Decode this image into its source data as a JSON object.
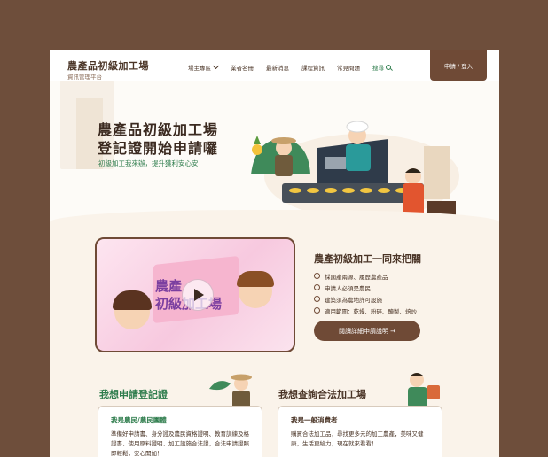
{
  "header": {
    "logo_title": "農產品初級加工場",
    "logo_subtitle": "資訊管理平台",
    "nav": [
      {
        "label": "場主專區",
        "has_dropdown": true
      },
      {
        "label": "業者名冊"
      },
      {
        "label": "最新消息"
      },
      {
        "label": "課程資訊"
      },
      {
        "label": "常見問題"
      },
      {
        "label": "搜尋",
        "icon": "search-icon"
      }
    ],
    "login_label": "申請 / 登入"
  },
  "hero": {
    "title_line1": "農產品初級加工場",
    "title_line2": "登記證開始申請囉",
    "subtitle": "初級加工我來辦，提升獲利安心安"
  },
  "video": {
    "text_line1": "農產",
    "text_line2": "初級加工場"
  },
  "info": {
    "title": "農產初級加工一同來把關",
    "items": [
      "採國產兩源、履歷農產品",
      "申請人必須是農民",
      "建築須為農地許可設施",
      "適用範圍：乾燥、粉碎、醃製、焙炒"
    ],
    "button_label": "閱讀詳細申請說明 →"
  },
  "sections": {
    "left": {
      "title": "我想申請登記證",
      "card_title": "我是農民/農民團體",
      "card_body": "準備好申請書、身分證及農民資格證明、教育訓練及格證書、使用原料證明、加工設施合法證，合法申請證照即輕鬆，安心開加！"
    },
    "right": {
      "title": "我想查詢合法加工場",
      "card_title": "我是一般消費者",
      "card_body": "購買合法加工品，尋找更多元的加工農產，美味又健康，生活更給力，現在就來看看！"
    }
  },
  "colors": {
    "frame": "#6e4e3b",
    "brand_brown": "#6f4a36",
    "accent_green": "#2f7d4d",
    "text_dark": "#3b2a20"
  }
}
